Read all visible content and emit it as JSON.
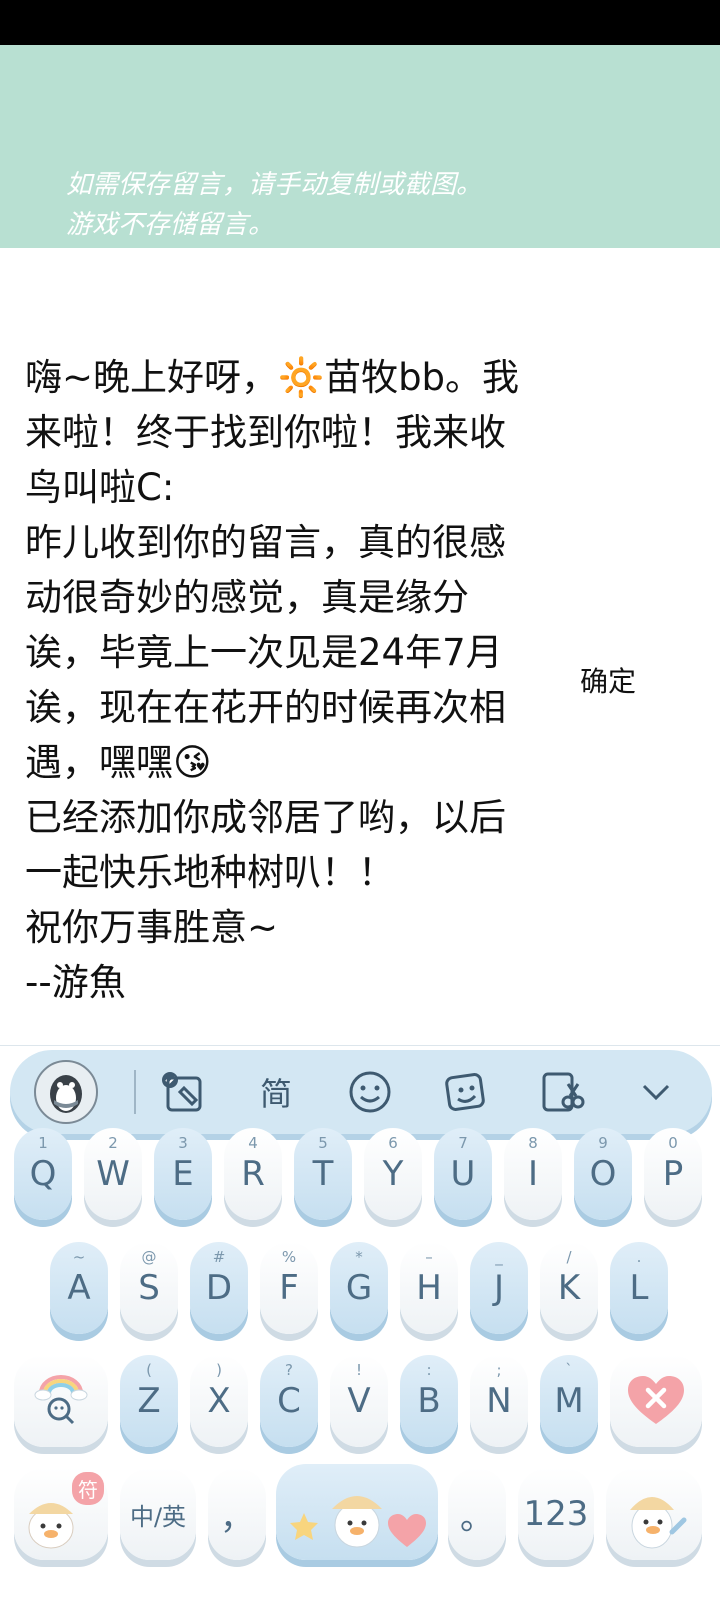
{
  "banner": {
    "line1": "如需保存留言，请手动复制或截图。",
    "line2": "游戏不存储留言。"
  },
  "message": {
    "text": "嗨~晚上好呀，🔆苗牧bb。我来啦！终于找到你啦！我来收鸟叫啦C:\n昨儿收到你的留言，真的很感动很奇妙的感觉，真是缘分诶，毕竟上一次见是24年7月诶，现在在花开的时候再次相遇，嘿嘿😘\n已经添加你成邻居了哟，以后一起快乐地种树叭！！\n祝你万事胜意~\n--游魚"
  },
  "confirm_label": "确定",
  "keyboard": {
    "toolbar": {
      "mode_label": "简",
      "icons": [
        "avatar-icon",
        "handwriting-icon",
        "emoji-icon",
        "sticker-icon",
        "clipboard-icon",
        "collapse-icon"
      ]
    },
    "row1": [
      {
        "main": "Q",
        "sub": "1"
      },
      {
        "main": "W",
        "sub": "2"
      },
      {
        "main": "E",
        "sub": "3"
      },
      {
        "main": "R",
        "sub": "4"
      },
      {
        "main": "T",
        "sub": "5"
      },
      {
        "main": "Y",
        "sub": "6"
      },
      {
        "main": "U",
        "sub": "7"
      },
      {
        "main": "I",
        "sub": "8"
      },
      {
        "main": "O",
        "sub": "9"
      },
      {
        "main": "P",
        "sub": "0"
      }
    ],
    "row2": [
      {
        "main": "A",
        "sub": "~"
      },
      {
        "main": "S",
        "sub": "@"
      },
      {
        "main": "D",
        "sub": "#"
      },
      {
        "main": "F",
        "sub": "%"
      },
      {
        "main": "G",
        "sub": "*"
      },
      {
        "main": "H",
        "sub": "–"
      },
      {
        "main": "J",
        "sub": "_"
      },
      {
        "main": "K",
        "sub": "/"
      },
      {
        "main": "L",
        "sub": "."
      }
    ],
    "row3": [
      {
        "main": "Z",
        "sub": "("
      },
      {
        "main": "X",
        "sub": ")"
      },
      {
        "main": "C",
        "sub": "?"
      },
      {
        "main": "V",
        "sub": "!"
      },
      {
        "main": "B",
        "sub": ":"
      },
      {
        "main": "N",
        "sub": ";"
      },
      {
        "main": "M",
        "sub": "`"
      }
    ],
    "symbol_badge": "符",
    "lang_label": "中/英",
    "comma": "，",
    "period": "。",
    "num_label": "123"
  },
  "colors": {
    "banner": "#b8e0d2",
    "key_blue": "#c6dff0",
    "delete_red": "#f4a3a8"
  }
}
